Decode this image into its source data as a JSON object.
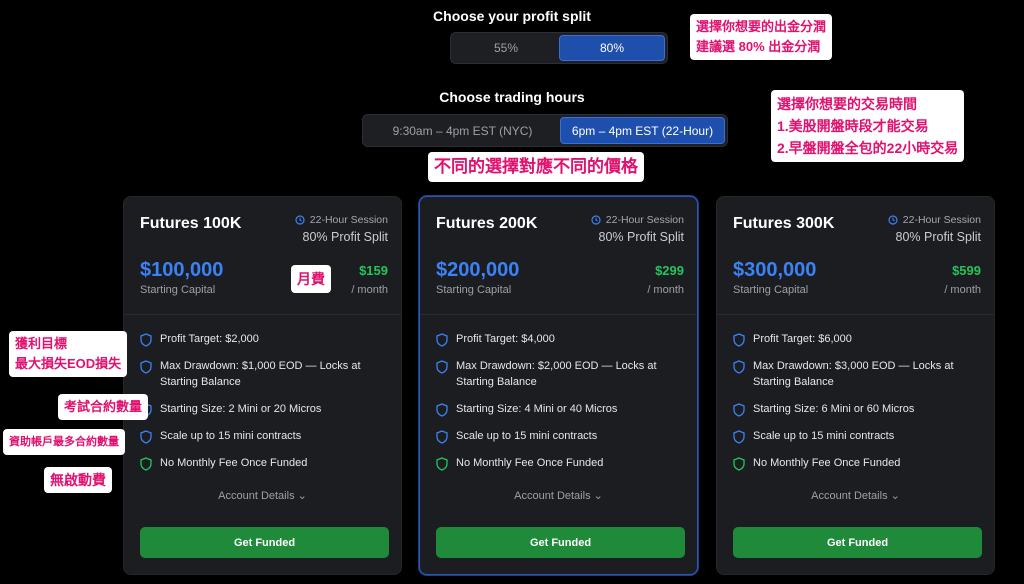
{
  "profit_split": {
    "title": "Choose your profit split",
    "options": [
      "55%",
      "80%"
    ],
    "selected": "80%"
  },
  "trading_hours": {
    "title": "Choose trading hours",
    "options": [
      "9:30am – 4pm EST (NYC)",
      "6pm – 4pm EST (22-Hour)"
    ],
    "selected": "6pm – 4pm EST (22-Hour)"
  },
  "annotations": {
    "split_line1": "選擇你想要的出金分潤",
    "split_line2": "建議選 80% 出金分潤",
    "hours_line1": "選擇你想要的交易時間",
    "hours_line2": "1.美股開盤時段才能交易",
    "hours_line3": "2.早盤開盤全包的22小時交易",
    "price_note": "不同的選擇對應不同的價格",
    "monthly_fee": "月費",
    "profit_target_1": "獲利目標",
    "profit_target_2": "最大損失EOD損失",
    "size": "考試合約數量",
    "funded_max": "資助帳戶最多合約數量",
    "no_activation": "無啟動費"
  },
  "plans": [
    {
      "name": "Futures 100K",
      "session": "22-Hour Session",
      "split": "80% Profit Split",
      "capital": "$100,000",
      "capital_label": "Starting Capital",
      "price": "$159",
      "per": "/ month",
      "features": [
        "Profit Target: $2,000",
        "Max Drawdown: $1,000 EOD — Locks at Starting Balance",
        "Starting Size: 2 Mini or 20 Micros",
        "Scale up to 15 mini contracts",
        "No Monthly Fee Once Funded"
      ],
      "details": "Account Details",
      "cta": "Get Funded"
    },
    {
      "name": "Futures 200K",
      "session": "22-Hour Session",
      "split": "80% Profit Split",
      "capital": "$200,000",
      "capital_label": "Starting Capital",
      "price": "$299",
      "per": "/ month",
      "features": [
        "Profit Target: $4,000",
        "Max Drawdown: $2,000 EOD — Locks at Starting Balance",
        "Starting Size: 4 Mini or 40 Micros",
        "Scale up to 15 mini contracts",
        "No Monthly Fee Once Funded"
      ],
      "details": "Account Details",
      "cta": "Get Funded"
    },
    {
      "name": "Futures 300K",
      "session": "22-Hour Session",
      "split": "80% Profit Split",
      "capital": "$300,000",
      "capital_label": "Starting Capital",
      "price": "$599",
      "per": "/ month",
      "features": [
        "Profit Target: $6,000",
        "Max Drawdown: $3,000 EOD — Locks at Starting Balance",
        "Starting Size: 6 Mini or 60 Micros",
        "Scale up to 15 mini contracts",
        "No Monthly Fee Once Funded"
      ],
      "details": "Account Details",
      "cta": "Get Funded"
    }
  ],
  "colors": {
    "accent_blue": "#3b82f6",
    "price_green": "#22c55e",
    "cta_green": "#1f8a3a",
    "annotation_pink": "#e0116f"
  }
}
